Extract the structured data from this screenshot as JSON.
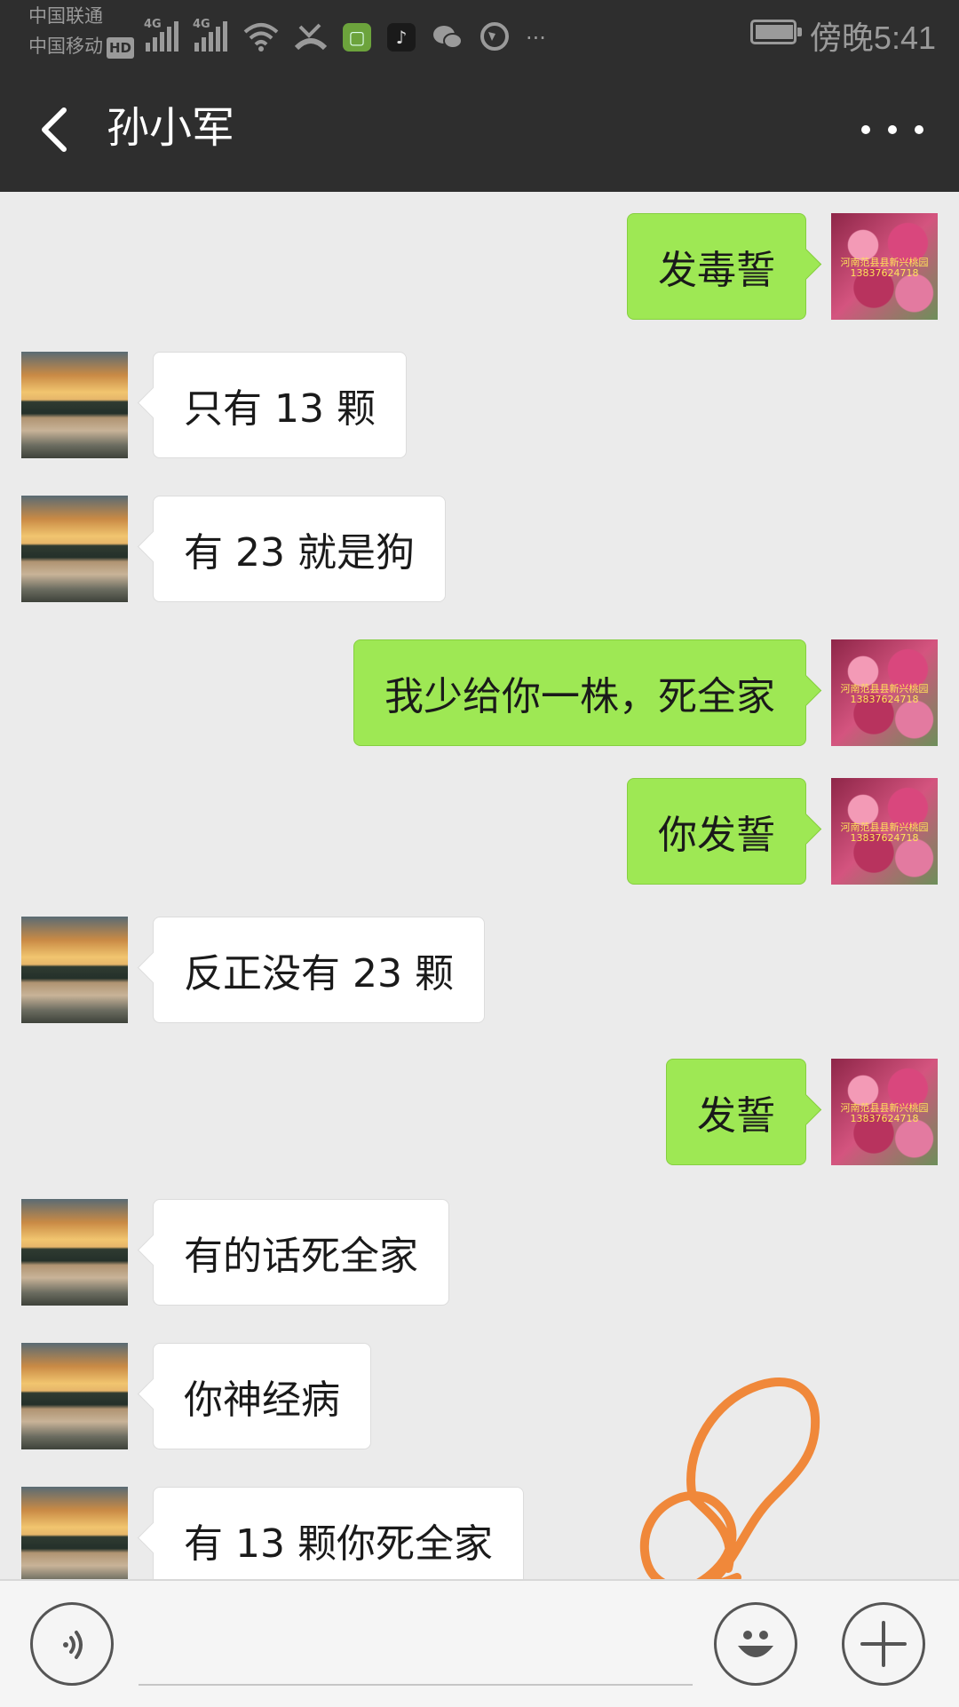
{
  "status_bar": {
    "carrier_1": "中国联通",
    "carrier_2": "中国移动",
    "hd_badge": "HD",
    "network_1": "4G",
    "network_2": "4G",
    "time": "傍晚5:41",
    "more_indicator": "···",
    "icons": [
      "signal-icon",
      "wifi-icon",
      "missed-call-icon",
      "app-icon",
      "tiktok-icon",
      "wechat-icon",
      "browser-icon",
      "battery-icon"
    ]
  },
  "header": {
    "title": "孙小军",
    "back_icon": "chevron-left-icon",
    "menu_icon": "more-dots-icon"
  },
  "avatars": {
    "self_watermark_line1": "河南范县县新兴桃园",
    "self_watermark_line2": "13837624718"
  },
  "messages": [
    {
      "side": "out",
      "text": "发毒誓"
    },
    {
      "side": "in",
      "text": "只有 13 颗"
    },
    {
      "side": "in",
      "text": "有 23 就是狗"
    },
    {
      "side": "out",
      "text": "我少给你一株，死全家"
    },
    {
      "side": "out",
      "text": "你发誓"
    },
    {
      "side": "in",
      "text": "反正没有 23 颗"
    },
    {
      "side": "out",
      "text": "发誓"
    },
    {
      "side": "in",
      "text": "有的话死全家"
    },
    {
      "side": "in",
      "text": "你神经病"
    },
    {
      "side": "in",
      "text": "有 13 颗你死全家"
    }
  ],
  "input_bar": {
    "voice_icon": "voice-icon",
    "emoji_icon": "emoji-icon",
    "plus_icon": "plus-icon",
    "text_value": ""
  },
  "annotation": {
    "color": "#f0883a"
  },
  "colors": {
    "bar_bg": "#2e2e2e",
    "chat_bg": "#ebebeb",
    "outgoing_bubble": "#9ee854",
    "incoming_bubble": "#ffffff"
  }
}
